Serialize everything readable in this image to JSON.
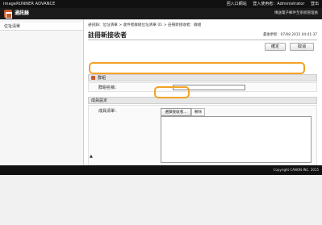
{
  "topbar": {
    "brand": "imageRUNNER ADVANCE",
    "link1": "回入口網站",
    "login_label": "登入使用者：",
    "user": "Administrator",
    "logout": "登出"
  },
  "appbar": {
    "title": "通訊錄",
    "subtitle": "傳送電子郵件至系統管理員"
  },
  "sidebar": {
    "items": [
      {
        "label": "位址清單"
      }
    ]
  },
  "breadcrumb": "通訊錄：位址清單 > 收件者群組位址清單 01 > 註冊新接收者：群組",
  "page": {
    "title": "註冊新接收者",
    "last_updated": "最後更新：07/08 2015 04:41:37",
    "ok_button": "確定",
    "cancel_button": "取消"
  },
  "group_section": {
    "header": "群組",
    "name_label": "群組名稱：",
    "name_value": ""
  },
  "member_section": {
    "header": "成員設定",
    "member_list_label": "成員清單：",
    "select_recipient_button": "選擇接收者...",
    "delete_button": "刪除"
  },
  "to_top": "▲",
  "footer": {
    "copyright": "Copyright CANON INC. 2015"
  },
  "colors": {
    "highlight": "#f2a225",
    "app_icon": "#c75a2a",
    "topbar_bg": "#111111"
  }
}
